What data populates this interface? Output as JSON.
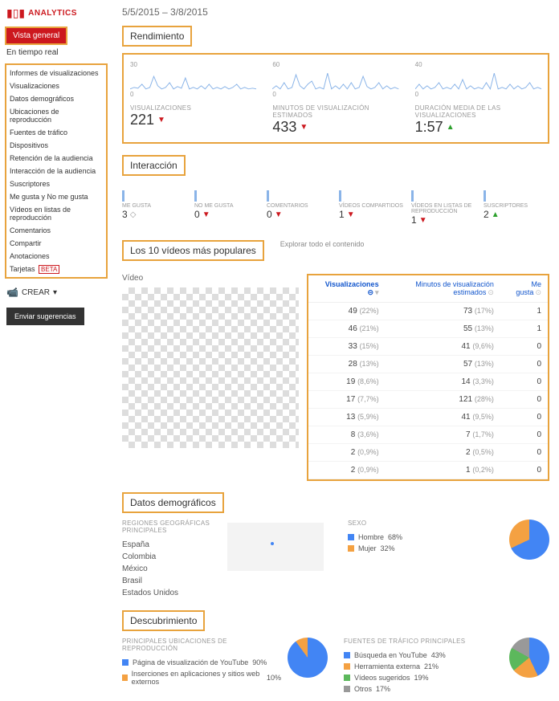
{
  "sidebar": {
    "logo": "ANALYTICS",
    "active": "Vista general",
    "realtime": "En tiempo real",
    "reports_header": "Informes de visualizaciones",
    "items": [
      "Visualizaciones",
      "Datos demográficos",
      "Ubicaciones de reproducción",
      "Fuentes de tráfico",
      "Dispositivos",
      "Retención de la audiencia"
    ],
    "interaction_header": "Interacción de la audiencia",
    "interaction_items": [
      "Suscriptores",
      "Me gusta y No me gusta",
      "Vídeos en listas de reproducción",
      "Comentarios",
      "Compartir",
      "Anotaciones"
    ],
    "tarjetas": "Tarjetas",
    "beta": "BETA",
    "crear": "CREAR",
    "sugerencias": "Enviar sugerencias"
  },
  "date_range": "5/5/2015 – 3/8/2015",
  "performance": {
    "title": "Rendimiento",
    "ylabels": [
      "30",
      "15",
      "0"
    ],
    "ylabels2": [
      "60",
      "30",
      "0"
    ],
    "ylabels3": [
      "40",
      "20",
      "0"
    ],
    "metrics": [
      {
        "label": "VISUALIZACIONES",
        "value": "221",
        "trend": "down"
      },
      {
        "label": "MINUTOS DE VISUALIZACIÓN ESTIMADOS",
        "value": "433",
        "trend": "down"
      },
      {
        "label": "DURACIÓN MEDIA DE LAS VISUALIZACIONES",
        "value": "1:57",
        "trend": "up"
      }
    ]
  },
  "interaction": {
    "title": "Interacción",
    "metrics": [
      {
        "label": "ME GUSTA",
        "value": "3",
        "trend": "neutral"
      },
      {
        "label": "NO ME GUSTA",
        "value": "0",
        "trend": "down"
      },
      {
        "label": "COMENTARIOS",
        "value": "0",
        "trend": "down"
      },
      {
        "label": "VÍDEOS COMPARTIDOS",
        "value": "1",
        "trend": "down"
      },
      {
        "label": "VÍDEOS EN LISTAS DE REPRODUCCIÓN",
        "value": "1",
        "trend": "down"
      },
      {
        "label": "SUSCRIPTORES",
        "value": "2",
        "trend": "up"
      }
    ]
  },
  "top_videos": {
    "title": "Los 10 vídeos más populares",
    "explore": "Explorar todo el contenido",
    "video_label": "Vídeo",
    "headers": [
      "Visualizaciones",
      "Minutos de visualización estimados",
      "Me gusta"
    ],
    "rows": [
      {
        "views": "49",
        "views_pct": "(22%)",
        "minutes": "73",
        "minutes_pct": "(17%)",
        "likes": "1"
      },
      {
        "views": "46",
        "views_pct": "(21%)",
        "minutes": "55",
        "minutes_pct": "(13%)",
        "likes": "1"
      },
      {
        "views": "33",
        "views_pct": "(15%)",
        "minutes": "41",
        "minutes_pct": "(9,6%)",
        "likes": "0"
      },
      {
        "views": "28",
        "views_pct": "(13%)",
        "minutes": "57",
        "minutes_pct": "(13%)",
        "likes": "0"
      },
      {
        "views": "19",
        "views_pct": "(8,6%)",
        "minutes": "14",
        "minutes_pct": "(3,3%)",
        "likes": "0"
      },
      {
        "views": "17",
        "views_pct": "(7,7%)",
        "minutes": "121",
        "minutes_pct": "(28%)",
        "likes": "0"
      },
      {
        "views": "13",
        "views_pct": "(5,9%)",
        "minutes": "41",
        "minutes_pct": "(9,5%)",
        "likes": "0"
      },
      {
        "views": "8",
        "views_pct": "(3,6%)",
        "minutes": "7",
        "minutes_pct": "(1,7%)",
        "likes": "0"
      },
      {
        "views": "2",
        "views_pct": "(0,9%)",
        "minutes": "2",
        "minutes_pct": "(0,5%)",
        "likes": "0"
      },
      {
        "views": "2",
        "views_pct": "(0,9%)",
        "minutes": "1",
        "minutes_pct": "(0,2%)",
        "likes": "0"
      }
    ]
  },
  "demographics": {
    "title": "Datos demográficos",
    "regions_title": "REGIONES GEOGRÁFICAS PRINCIPALES",
    "regions": [
      "España",
      "Colombia",
      "México",
      "Brasil",
      "Estados Unidos"
    ],
    "gender_title": "SEXO",
    "gender": [
      {
        "label": "Hombre",
        "pct": "68%",
        "color": "#4285f4"
      },
      {
        "label": "Mujer",
        "pct": "32%",
        "color": "#f4a142"
      }
    ]
  },
  "discovery": {
    "title": "Descubrimiento",
    "playback_title": "PRINCIPALES UBICACIONES DE REPRODUCCIÓN",
    "playback": [
      {
        "label": "Página de visualización de YouTube",
        "pct": "90%",
        "color": "#4285f4"
      },
      {
        "label": "Inserciones en aplicaciones y sitios web externos",
        "pct": "10%",
        "color": "#f4a142"
      }
    ],
    "traffic_title": "FUENTES DE TRÁFICO PRINCIPALES",
    "traffic": [
      {
        "label": "Búsqueda en YouTube",
        "pct": "43%",
        "color": "#4285f4"
      },
      {
        "label": "Herramienta externa",
        "pct": "21%",
        "color": "#f4a142"
      },
      {
        "label": "Vídeos sugeridos",
        "pct": "19%",
        "color": "#5cb85c"
      },
      {
        "label": "Otros",
        "pct": "17%",
        "color": "#999"
      }
    ]
  },
  "chart_data": [
    {
      "type": "line",
      "title": "Visualizaciones",
      "ylim": [
        0,
        30
      ],
      "note": "daily sparkline, ~90 days"
    },
    {
      "type": "line",
      "title": "Minutos de visualización estimados",
      "ylim": [
        0,
        60
      ],
      "note": "daily sparkline"
    },
    {
      "type": "line",
      "title": "Duración media",
      "ylim": [
        0,
        40
      ],
      "note": "daily sparkline"
    },
    {
      "type": "pie",
      "title": "Sexo",
      "series": [
        {
          "name": "Hombre",
          "value": 68
        },
        {
          "name": "Mujer",
          "value": 32
        }
      ]
    },
    {
      "type": "pie",
      "title": "Ubicaciones de reproducción",
      "series": [
        {
          "name": "YouTube page",
          "value": 90
        },
        {
          "name": "External embeds",
          "value": 10
        }
      ]
    },
    {
      "type": "pie",
      "title": "Fuentes de tráfico",
      "series": [
        {
          "name": "Búsqueda YouTube",
          "value": 43
        },
        {
          "name": "Herramienta externa",
          "value": 21
        },
        {
          "name": "Vídeos sugeridos",
          "value": 19
        },
        {
          "name": "Otros",
          "value": 17
        }
      ]
    }
  ]
}
